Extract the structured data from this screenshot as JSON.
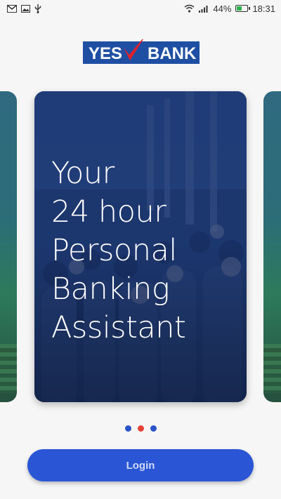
{
  "status_bar": {
    "left_icons": [
      "gmail-icon",
      "image-icon",
      "usb-icon"
    ],
    "battery_percent": "44%",
    "battery_level": 0.44,
    "time": "18:31"
  },
  "logo": {
    "text_left": "YES",
    "text_right": "BANK",
    "brand_blue": "#1f4fa3",
    "brand_red": "#e0202c"
  },
  "carousel": {
    "headline_lines": [
      "Your",
      "24 hour",
      "Personal",
      "Banking",
      "Assistant"
    ],
    "page_count": 3,
    "active_index": 1
  },
  "login": {
    "label": "Login",
    "color": "#2a56d6"
  }
}
